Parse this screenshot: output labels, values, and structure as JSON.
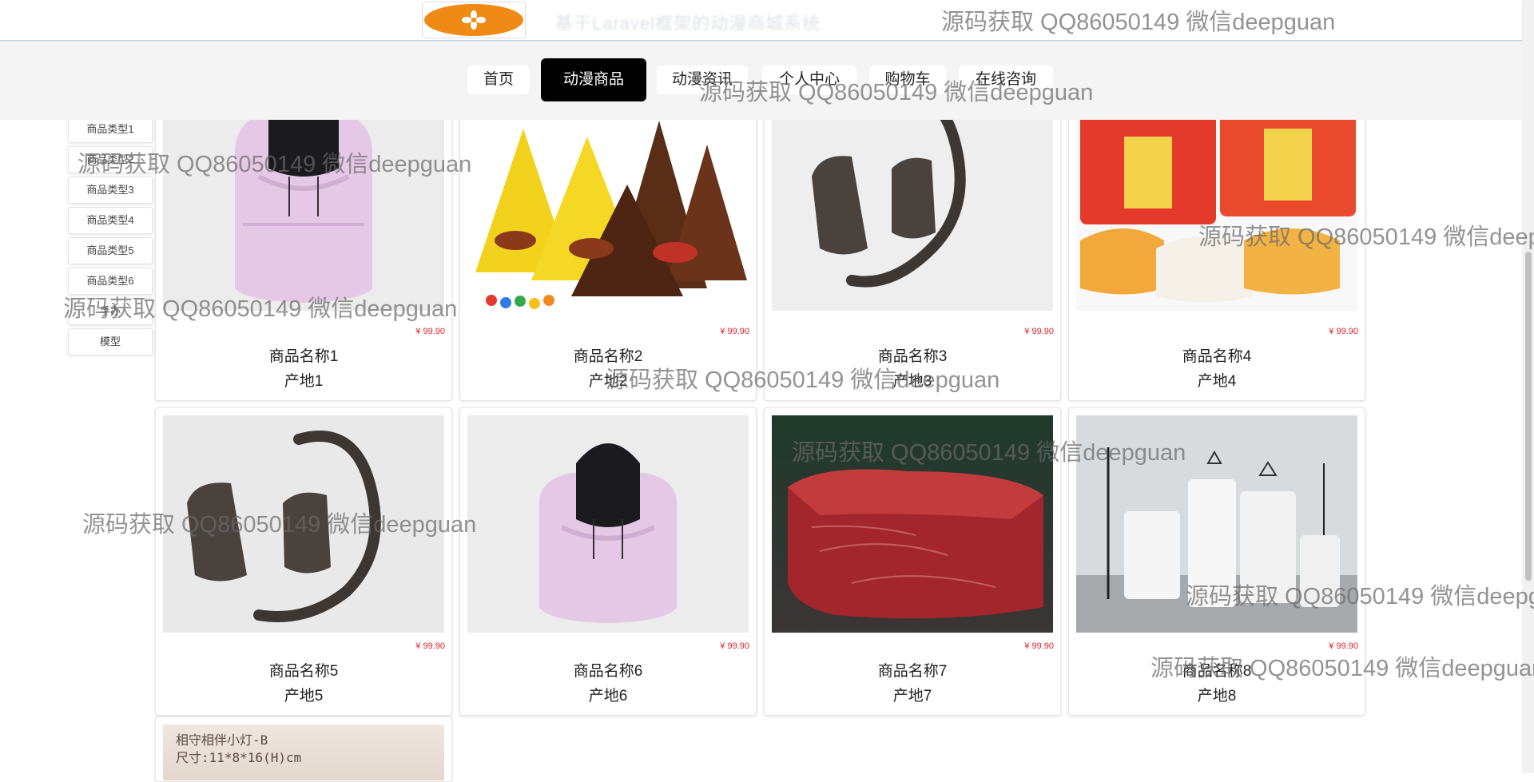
{
  "header": {
    "logo_icon": "flower-logo-icon",
    "title_blurred": "基于Laravel框架的动漫商城系统"
  },
  "nav": {
    "items": [
      {
        "label": "首页"
      },
      {
        "label": "动漫商品"
      },
      {
        "label": "动漫资讯"
      },
      {
        "label": "个人中心"
      },
      {
        "label": "购物车"
      },
      {
        "label": "在线咨询"
      }
    ],
    "active_index": 1
  },
  "sidebar": {
    "items": [
      {
        "label": "商品类型1"
      },
      {
        "label": "商品类型2"
      },
      {
        "label": "商品类型3"
      },
      {
        "label": "商品类型4"
      },
      {
        "label": "商品类型5"
      },
      {
        "label": "商品类型6"
      },
      {
        "label": "手办"
      },
      {
        "label": "模型"
      }
    ]
  },
  "products": [
    {
      "name": "商品名称1",
      "origin": "产地1",
      "price": "¥ 99.90",
      "image": "lilac-puffer-vest"
    },
    {
      "name": "商品名称2",
      "origin": "产地2",
      "price": "¥ 99.90",
      "image": "mm-chocolate-packs"
    },
    {
      "name": "商品名称3",
      "origin": "产地3",
      "price": "¥ 99.90",
      "image": "fur-gloves-scarf"
    },
    {
      "name": "商品名称4",
      "origin": "产地4",
      "price": "¥ 99.90",
      "image": "fruit-jelly-packs"
    },
    {
      "name": "商品名称5",
      "origin": "产地5",
      "price": "¥ 99.90",
      "image": "fur-gloves-scarf"
    },
    {
      "name": "商品名称6",
      "origin": "产地6",
      "price": "¥ 99.90",
      "image": "lilac-puffer-vest"
    },
    {
      "name": "商品名称7",
      "origin": "产地7",
      "price": "¥ 99.90",
      "image": "raw-beef-steak"
    },
    {
      "name": "商品名称8",
      "origin": "产地8",
      "price": "¥ 99.90",
      "image": "white-ornaments-display"
    }
  ],
  "partial_card": {
    "line1": "相守相伴小灯-B",
    "line2": "尺寸:11*8*16(H)cm"
  },
  "watermark": {
    "text": "源码获取 QQ86050149 微信deepguan"
  }
}
